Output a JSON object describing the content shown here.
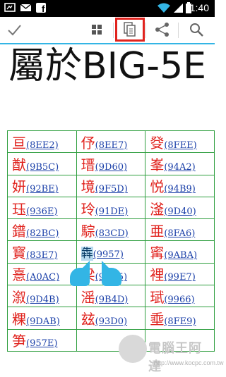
{
  "status_bar": {
    "time": "1:40",
    "icons": [
      "notification-icon",
      "mail-icon",
      "facebook-icon",
      "wifi-icon",
      "signal-icon",
      "battery-icon"
    ]
  },
  "action_bar": {
    "icons": [
      "check-icon",
      "select-all-icon",
      "copy-icon",
      "share-icon",
      "search-icon"
    ],
    "accent": "#33b5e5",
    "highlight_color": "#e0231e"
  },
  "title": "屬於BIG-5E",
  "table": {
    "rows": [
      [
        {
          "char": "亘",
          "code": "(8EE2)"
        },
        {
          "char": "伃",
          "code": "(8EE7)"
        },
        {
          "char": "癹",
          "code": "(8FEE)"
        }
      ],
      [
        {
          "char": "猷",
          "code": "(9B5C)"
        },
        {
          "char": "瑨",
          "code": "(9D60)"
        },
        {
          "char": "峯",
          "code": "(94A2)"
        }
      ],
      [
        {
          "char": "妍",
          "code": "(92BE)"
        },
        {
          "char": "境",
          "code": "(9F5D)"
        },
        {
          "char": "悦",
          "code": "(94B9)"
        }
      ],
      [
        {
          "char": "珏",
          "code": "(936E)"
        },
        {
          "char": "玲",
          "code": "(91DE)"
        },
        {
          "char": "滏",
          "code": "(9D40)"
        }
      ],
      [
        {
          "char": "鐠",
          "code": "(82BC)"
        },
        {
          "char": "騌",
          "code": "(83CD)"
        },
        {
          "char": "亜",
          "code": "(8FA6)"
        }
      ],
      [
        {
          "char": "寳",
          "code": "(83E7)"
        },
        {
          "char": "犇",
          "code": "(9957)"
        },
        {
          "char": "寗",
          "code": "(9ABA)"
        }
      ],
      [
        {
          "char": "憙",
          "code": "(A0AC)"
        },
        {
          "char": "梁",
          "code": "(96D5)"
        },
        {
          "char": "裡",
          "code": "(99E7)"
        }
      ],
      [
        {
          "char": "溆",
          "code": "(9D4B)"
        },
        {
          "char": "滛",
          "code": "(9B4D)"
        },
        {
          "char": "珷",
          "code": "(9966)"
        }
      ],
      [
        {
          "char": "粿",
          "code": "(9DAB)"
        },
        {
          "char": "玆",
          "code": "(93D0)"
        },
        {
          "char": "埀",
          "code": "(8FE9)"
        }
      ],
      [
        {
          "char": "笋",
          "code": "(957E)"
        },
        {
          "char": "",
          "code": ""
        },
        {
          "char": "",
          "code": ""
        }
      ]
    ],
    "colors": {
      "char": "#e0231e",
      "code": "#1a3fa8",
      "border": "#2e9e3e"
    }
  },
  "watermark": {
    "name": "電腦王阿達",
    "url": "http://www.kocpc.com.tw"
  }
}
